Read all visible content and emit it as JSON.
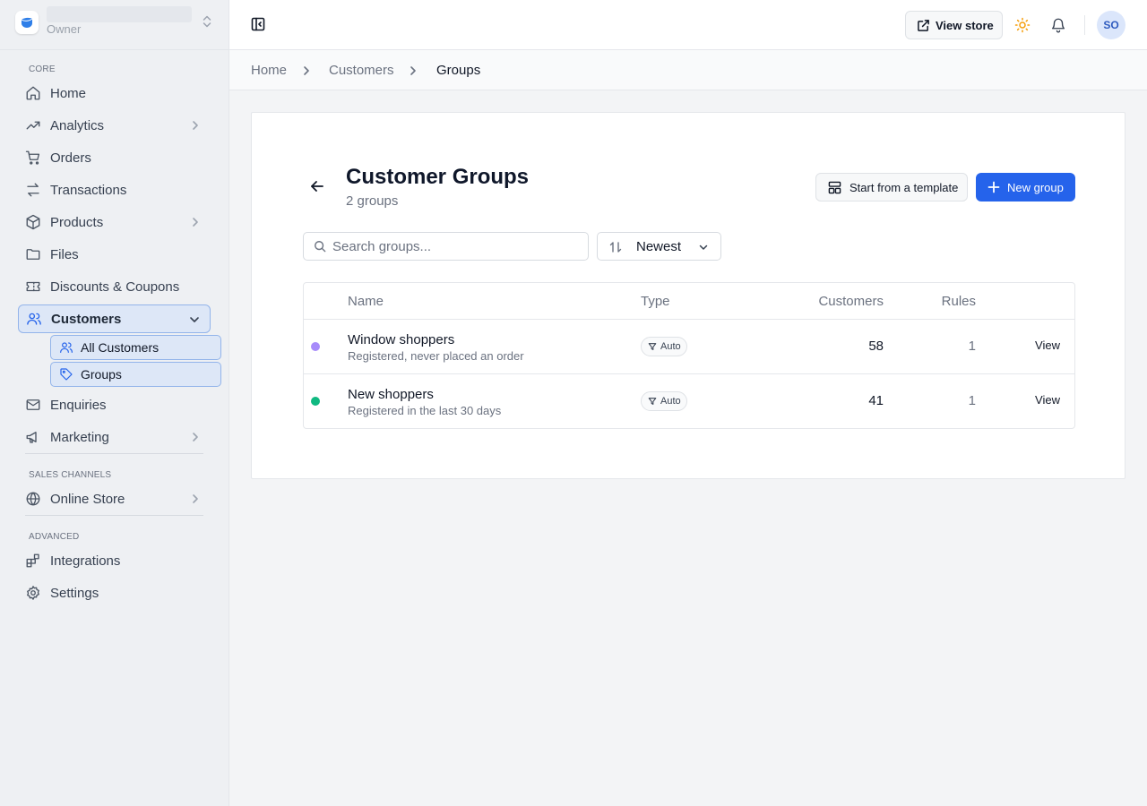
{
  "store": {
    "role": "Owner"
  },
  "sidebar": {
    "sections": {
      "core": "CORE",
      "sales_channels": "SALES CHANNELS",
      "advanced": "ADVANCED"
    },
    "items": {
      "home": "Home",
      "analytics": "Analytics",
      "orders": "Orders",
      "transactions": "Transactions",
      "products": "Products",
      "files": "Files",
      "discounts": "Discounts & Coupons",
      "customers": "Customers",
      "all_customers": "All Customers",
      "groups": "Groups",
      "enquiries": "Enquiries",
      "marketing": "Marketing",
      "online_store": "Online Store",
      "integrations": "Integrations",
      "settings": "Settings"
    }
  },
  "topbar": {
    "view_store": "View store",
    "avatar_initials": "SO"
  },
  "breadcrumb": {
    "home": "Home",
    "customers": "Customers",
    "groups": "Groups"
  },
  "page": {
    "title": "Customer Groups",
    "subtitle": "2 groups",
    "template_button": "Start from a template",
    "new_button": "New group",
    "search_placeholder": "Search groups...",
    "sort_label": "Newest"
  },
  "table": {
    "headers": {
      "name": "Name",
      "type": "Type",
      "customers": "Customers",
      "rules": "Rules"
    },
    "rows": [
      {
        "name": "Window shoppers",
        "description": "Registered, never placed an order",
        "type": "Auto",
        "customers": "58",
        "rules": "1",
        "action": "View",
        "color": "#a78bfa"
      },
      {
        "name": "New shoppers",
        "description": "Registered in the last 30 days",
        "type": "Auto",
        "customers": "41",
        "rules": "1",
        "action": "View",
        "color": "#10b981"
      }
    ]
  },
  "colors": {
    "accent": "#2563eb",
    "active_bg": "#dde7f7",
    "active_border": "#93b4ea"
  }
}
